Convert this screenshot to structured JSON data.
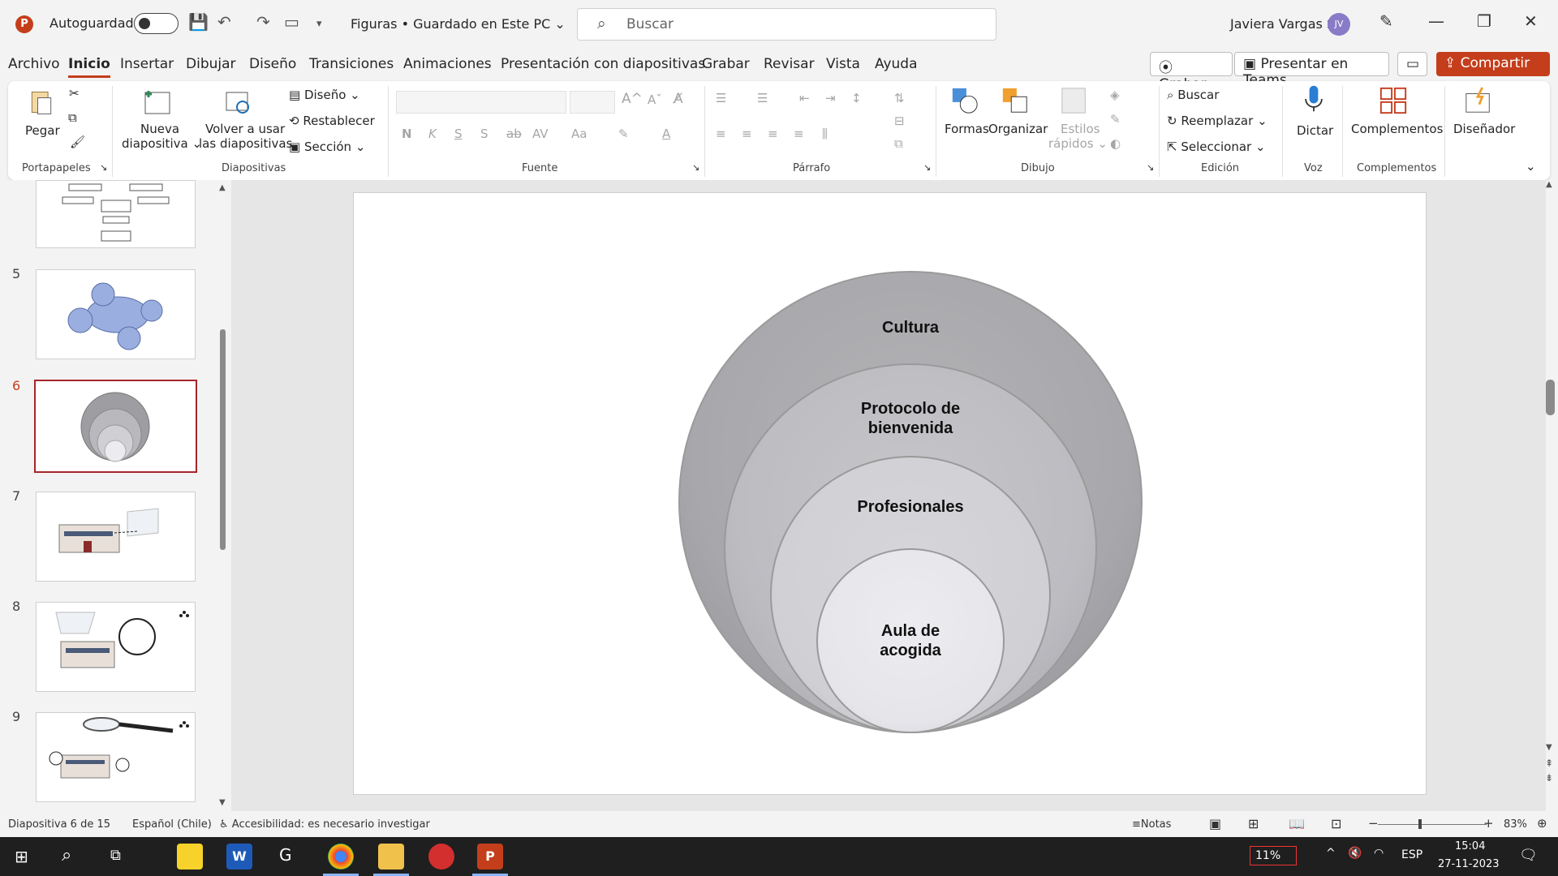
{
  "titlebar": {
    "app_logo": "P",
    "autosave_label": "Autoguardado",
    "doc_title": "Figuras • Guardado en Este PC ⌄",
    "search_placeholder": "Buscar",
    "user_name": "Javiera Vargas S.",
    "avatar_initials": "JV"
  },
  "menu": {
    "items": [
      "Archivo",
      "Inicio",
      "Insertar",
      "Dibujar",
      "Diseño",
      "Transiciones",
      "Animaciones",
      "Presentación con diapositivas",
      "Grabar",
      "Revisar",
      "Vista",
      "Ayuda"
    ],
    "active": "Inicio",
    "record_label": "Grabar",
    "teams_label": "Presentar en Teams",
    "share_label": "Compartir"
  },
  "ribbon": {
    "portapapeles": {
      "pegar": "Pegar",
      "group": "Portapapeles"
    },
    "diapositivas": {
      "nueva": "Nueva",
      "nueva2": "diapositiva ⌄",
      "volver": "Volver a usar",
      "volver2": "las diapositivas",
      "diseno": "Diseño ⌄",
      "restablecer": "Restablecer",
      "seccion": "Sección ⌄",
      "group": "Diapositivas"
    },
    "fuente": {
      "bold": "N",
      "italic": "K",
      "underline": "S",
      "shadow": "S",
      "strike": "ab",
      "spacing": "AV",
      "case": "Aa",
      "group": "Fuente"
    },
    "parrafo": {
      "group": "Párrafo"
    },
    "dibujo": {
      "formas": "Formas",
      "organizar": "Organizar",
      "estilos": "Estilos",
      "estilos2": "rápidos ⌄",
      "group": "Dibujo"
    },
    "edicion": {
      "buscar": "Buscar",
      "reemplazar": "Reemplazar",
      "seleccionar": "Seleccionar ⌄",
      "group": "Edición"
    },
    "voz": {
      "dictar": "Dictar",
      "group": "Voz"
    },
    "complementos": {
      "label": "Complementos",
      "group": "Complementos"
    },
    "disenador": {
      "label": "Diseñador"
    }
  },
  "thumbnails": [
    {
      "num": "5"
    },
    {
      "num": "6",
      "selected": true
    },
    {
      "num": "7"
    },
    {
      "num": "8"
    },
    {
      "num": "9"
    }
  ],
  "slide": {
    "labels": [
      "Cultura",
      "Protocolo de\nbienvenida",
      "Profesionales",
      "Aula de\nacogida"
    ]
  },
  "status": {
    "slide_count": "Diapositiva 6 de 15",
    "language": "Español (Chile)",
    "accessibility": "Accesibilidad: es necesario investigar",
    "notes": "Notas",
    "zoom": "83%"
  },
  "taskbar": {
    "battery": "11%",
    "lang": "ESP",
    "time": "15:04",
    "date": "27-11-2023"
  }
}
